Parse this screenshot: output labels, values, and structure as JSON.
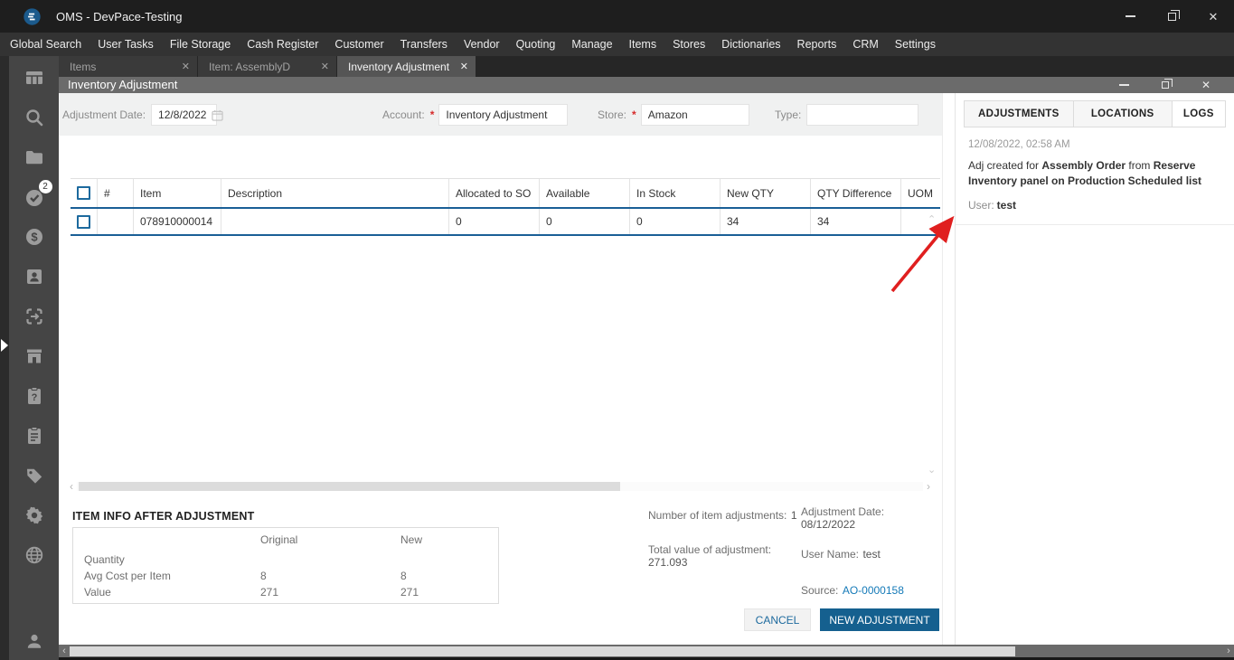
{
  "window": {
    "title": "OMS - DevPace-Testing",
    "controls": {
      "minimize": "minimize",
      "restore": "restore",
      "close": "✕"
    }
  },
  "menu": {
    "items": [
      "Global Search",
      "User Tasks",
      "File Storage",
      "Cash Register",
      "Customer",
      "Transfers",
      "Vendor",
      "Quoting",
      "Manage",
      "Items",
      "Stores",
      "Dictionaries",
      "Reports",
      "CRM",
      "Settings"
    ]
  },
  "doc_tabs": [
    {
      "label": "Items",
      "close": "✕",
      "active": false
    },
    {
      "label": "Item: AssemblyD",
      "close": "✕",
      "active": false
    },
    {
      "label": "Inventory Adjustment",
      "close": "✕",
      "active": true
    }
  ],
  "inner_window": {
    "title": "Inventory Adjustment",
    "close": "✕"
  },
  "sidebar": {
    "badge_count": "2",
    "icons": [
      "dashboard",
      "search",
      "folder",
      "tasks-check",
      "finance-dollar",
      "contact-card",
      "transfer-box",
      "storefront",
      "clipboard-question",
      "clipboard-list",
      "tag",
      "settings-gear",
      "globe",
      "user-profile"
    ]
  },
  "form": {
    "required_marker": "*",
    "date_label": "Adjustment Date:",
    "date_value": "12/8/2022",
    "account_label": "Account:",
    "account_value": "Inventory Adjustment",
    "store_label": "Store:",
    "store_value": "Amazon",
    "type_label": "Type:",
    "type_value": ""
  },
  "table": {
    "columns": [
      "#",
      "Item",
      "Description",
      "Allocated to SO",
      "Available",
      "In Stock",
      "New QTY",
      "QTY Difference",
      "UOM"
    ],
    "rows": [
      {
        "num": "",
        "item": "078910000014",
        "description": "",
        "allocated": "0",
        "available": "0",
        "in_stock": "0",
        "new_qty": "34",
        "qty_diff": "34",
        "uom": ""
      }
    ]
  },
  "item_info": {
    "heading": "ITEM INFO AFTER ADJUSTMENT",
    "col_original": "Original",
    "col_new": "New",
    "rows": [
      {
        "label": "Quantity",
        "original": "",
        "new": ""
      },
      {
        "label": "Avg Cost per Item",
        "original": "8",
        "new": "8"
      },
      {
        "label": "Value",
        "original": "271",
        "new": "271"
      }
    ]
  },
  "summary": {
    "number_label": "Number of item adjustments:",
    "number_value": "1",
    "total_label": "Total value of adjustment:",
    "total_value": "271.093",
    "adj_date_label": "Adjustment Date:",
    "adj_date_value": "08/12/2022",
    "user_label": "User Name:",
    "user_value": "test",
    "source_label": "Source:",
    "source_value": "AO-0000158"
  },
  "actions": {
    "cancel": "CANCEL",
    "new_adjustment": "NEW ADJUSTMENT"
  },
  "panel": {
    "tabs": [
      "ADJUSTMENTS",
      "LOCATIONS",
      "LOGS"
    ],
    "active_tab": "LOGS",
    "log": {
      "timestamp": "12/08/2022, 02:58 AM",
      "parts": [
        "Adj created for ",
        "Assembly Order",
        " from ",
        "Reserve Inventory panel on Production Scheduled list"
      ],
      "user_label": "User:",
      "user_value": "test"
    }
  },
  "colors": {
    "accent_blue": "#15608f",
    "table_line_blue": "#1a5f96",
    "link_blue": "#157ab8",
    "required_red": "#d62b2b",
    "annotation_arrow_red": "#e01f1f",
    "titlebar_dark": "#1e1e1e",
    "sidebar_gray": "#454545"
  }
}
